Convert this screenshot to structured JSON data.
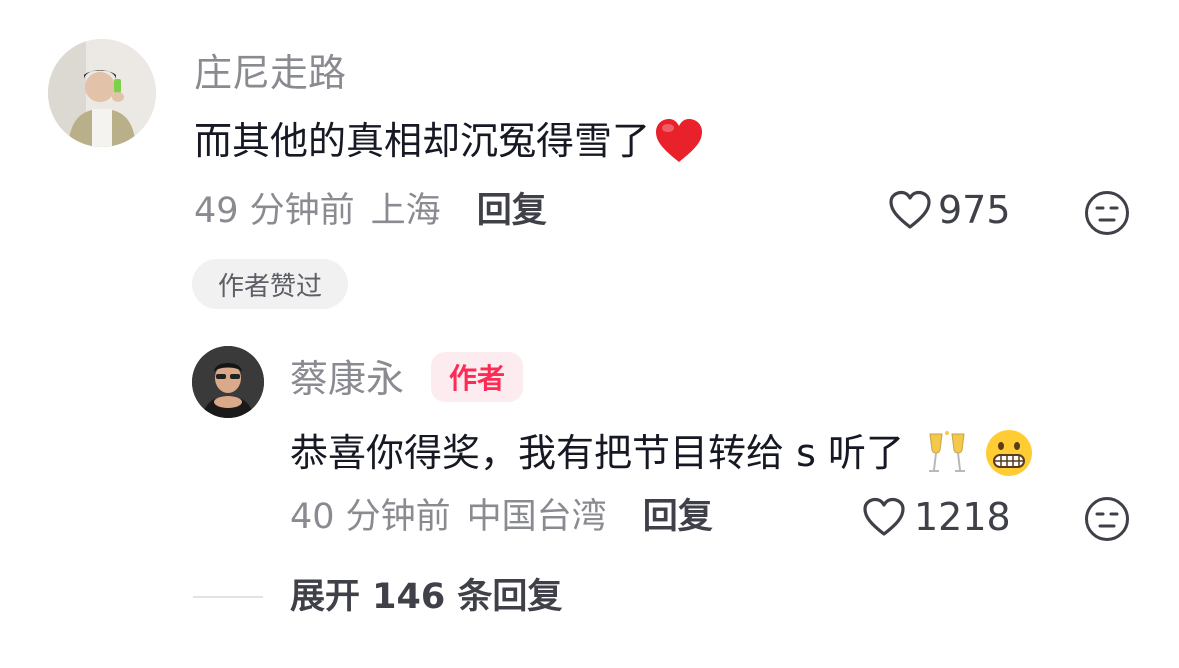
{
  "comment": {
    "username": "庄尼走路",
    "text": "而其他的真相却沉冤得雪了",
    "text_emoji": "heart-emoji",
    "time": "49 分钟前",
    "location": "上海",
    "reply_label": "回复",
    "like_count": "975",
    "author_liked_label": "作者赞过"
  },
  "reply": {
    "username": "蔡康永",
    "author_tag": "作者",
    "text": "恭喜你得奖，我有把节目转给 s 听了",
    "text_emojis": [
      "champagne-emoji",
      "grimacing-face-emoji"
    ],
    "time": "40 分钟前",
    "location": "中国台湾",
    "reply_label": "回复",
    "like_count": "1218"
  },
  "expand": {
    "label": "展开 146 条回复"
  },
  "colors": {
    "author_red": "#fe2c55",
    "heart_red": "#e8212b",
    "meta_gray": "#8a8b91",
    "text_dark": "#161823"
  }
}
